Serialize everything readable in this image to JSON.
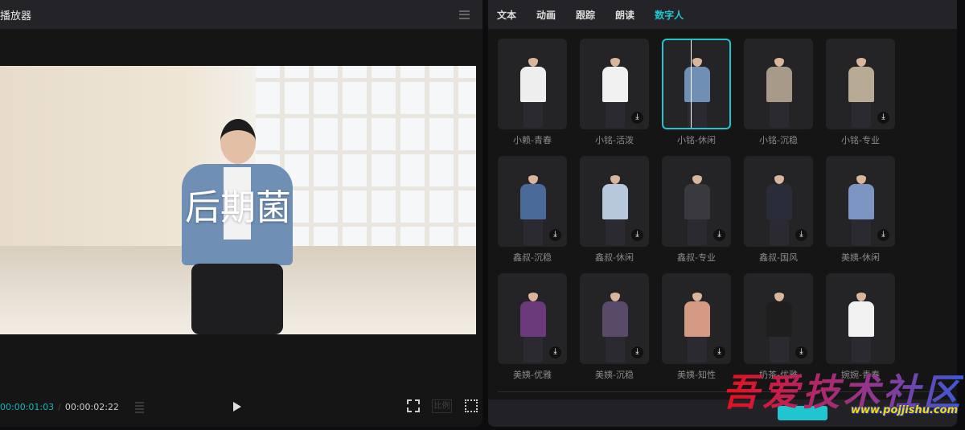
{
  "player": {
    "title": "播放器",
    "caption": "后期菌",
    "current_time": "00:00:01:03",
    "separator": "/",
    "total_time": "00:00:02:22",
    "ratio_label": "比例"
  },
  "panel": {
    "tabs": [
      {
        "label": "文本"
      },
      {
        "label": "动画"
      },
      {
        "label": "跟踪"
      },
      {
        "label": "朗读"
      },
      {
        "label": "数字人",
        "active": true
      }
    ],
    "avatars": [
      {
        "label": "小赖-青春",
        "color": "#eeeeee",
        "download": false
      },
      {
        "label": "小铭-活泼",
        "color": "#f0f0f0",
        "download": true
      },
      {
        "label": "小铭-休闲",
        "color": "#6f8fb5",
        "download": false,
        "selected": true
      },
      {
        "label": "小铭-沉稳",
        "color": "#a89a88",
        "download": false
      },
      {
        "label": "小铭-专业",
        "color": "#b8ab96",
        "download": true
      },
      {
        "label": "鑫叔-沉稳",
        "color": "#4a6a9a",
        "download": true
      },
      {
        "label": "鑫叔-休闲",
        "color": "#b8c8dc",
        "download": true
      },
      {
        "label": "鑫叔-专业",
        "color": "#3a3a3e",
        "download": true
      },
      {
        "label": "鑫叔-国风",
        "color": "#2a2c3a",
        "download": true
      },
      {
        "label": "美姨-休闲",
        "color": "#7d95c2",
        "download": true
      },
      {
        "label": "美姨-优雅",
        "color": "#6a3a7a",
        "download": true
      },
      {
        "label": "美姨-沉稳",
        "color": "#5a4a6a",
        "download": true
      },
      {
        "label": "美姨-知性",
        "color": "#d49a84",
        "download": true
      },
      {
        "label": "奶茶-优雅",
        "color": "#1e1e1e",
        "download": true
      },
      {
        "label": "婉婉-青春",
        "color": "#f2f2f2",
        "download": false
      }
    ],
    "download_glyph": "⤓"
  },
  "watermark": {
    "text": "吾爱技术社区",
    "url": "www.pojjishu.com"
  },
  "colors": {
    "accent": "#1fc6cf"
  }
}
